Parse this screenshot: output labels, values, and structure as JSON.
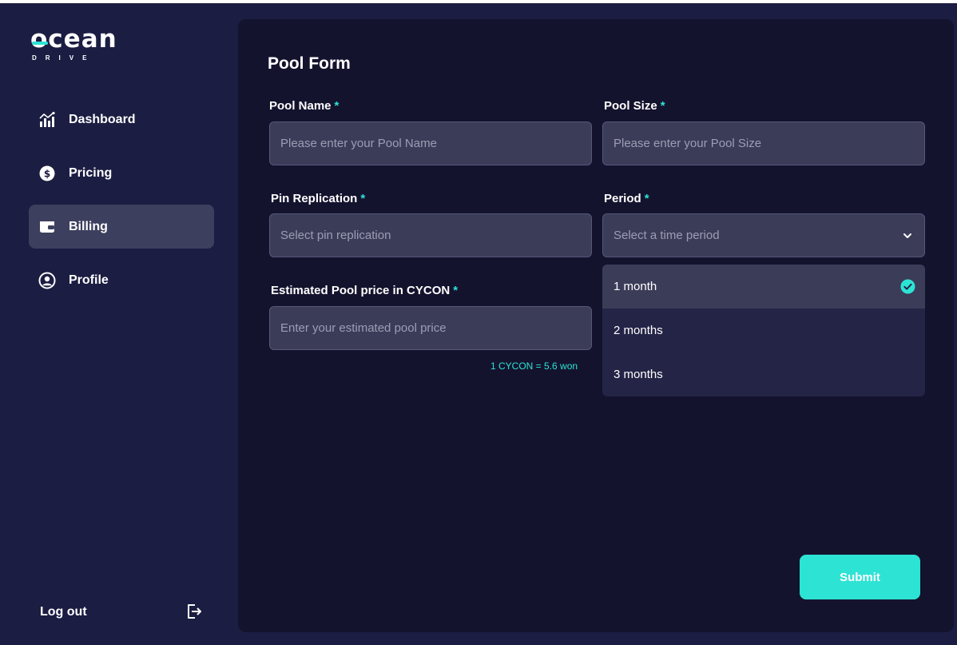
{
  "brand": {
    "name": "ocean",
    "sub": "DRIVE"
  },
  "sidebar": {
    "items": [
      {
        "label": "Dashboard",
        "icon": "chart-icon",
        "active": false
      },
      {
        "label": "Pricing",
        "icon": "dollar-icon",
        "active": false
      },
      {
        "label": "Billing",
        "icon": "wallet-icon",
        "active": true
      },
      {
        "label": "Profile",
        "icon": "user-circle-icon",
        "active": false
      }
    ],
    "logout_label": "Log out"
  },
  "form": {
    "title": "Pool Form",
    "required_mark": "*",
    "pool_name": {
      "label": "Pool Name",
      "placeholder": "Please enter your Pool Name"
    },
    "pool_size": {
      "label": "Pool Size",
      "placeholder": "Please enter your Pool Size"
    },
    "pin_replication": {
      "label": "Pin Replication",
      "placeholder": "Select pin replication"
    },
    "period": {
      "label": "Period",
      "placeholder": "Select a time period",
      "options": [
        "1 month",
        "2 months",
        "3 months"
      ],
      "selected_index": 0
    },
    "estimated_price": {
      "label": "Estimated Pool price in CYCON",
      "placeholder": "Enter your estimated pool price",
      "rate": "1 CYCON = 5.6 won"
    },
    "submit_label": "Submit"
  },
  "colors": {
    "accent": "#2de3d4",
    "background": "#1b1d42",
    "panel": "#14132e",
    "input": "#3b3c58"
  }
}
